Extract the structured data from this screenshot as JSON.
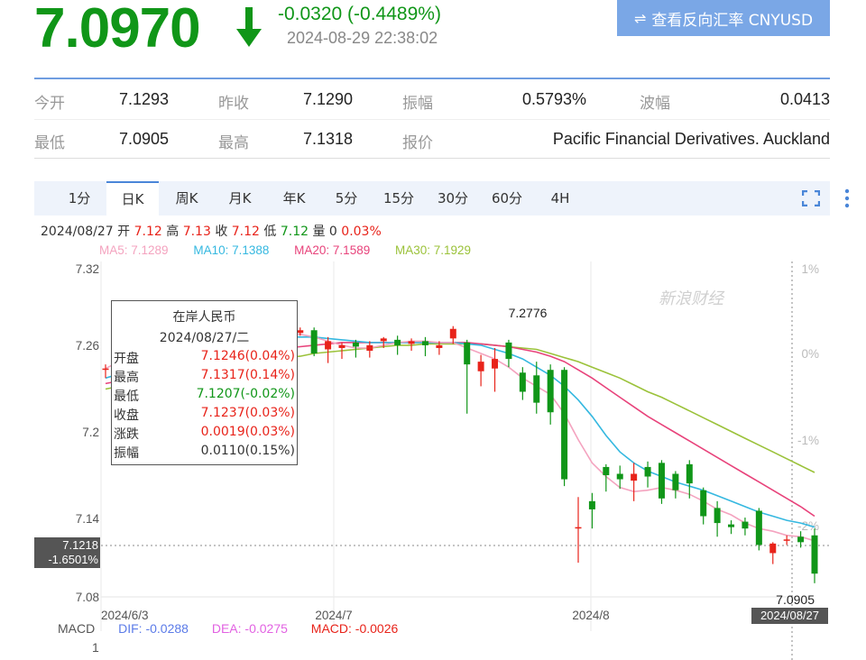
{
  "header": {
    "price": "7.0970",
    "change": "-0.0320 (-0.4489%)",
    "timestamp": "2024-08-29 22:38:02",
    "reverse_button_label": "查看反向汇率 CNYUSD",
    "colors": {
      "down": "#109618",
      "up": "#e8231a",
      "accent": "#7aa7e6"
    }
  },
  "quote": {
    "rows": [
      [
        {
          "label": "今开",
          "value": "7.1293"
        },
        {
          "label": "昨收",
          "value": "7.1290"
        },
        {
          "label": "振幅",
          "value": "0.5793%"
        },
        {
          "label": "波幅",
          "value": "0.0413"
        }
      ],
      [
        {
          "label": "最低",
          "value": "7.0905"
        },
        {
          "label": "最高",
          "value": "7.1318"
        },
        {
          "label": "报价",
          "value": "Pacific Financial Derivatives. Auckland"
        }
      ]
    ]
  },
  "tabs": [
    "1分",
    "日K",
    "周K",
    "月K",
    "年K",
    "5分",
    "15分",
    "30分",
    "60分",
    "4H"
  ],
  "active_tab": "日K",
  "icons": [
    "expand-icon",
    "more-vertical-icon",
    "swap-icon",
    "down-arrow-icon"
  ],
  "ohlc_line": {
    "date": "2024/08/27",
    "open_label": "开",
    "open": "7.12",
    "high_label": "高",
    "high": "7.13",
    "close_label": "收",
    "close": "7.12",
    "low_label": "低",
    "low": "7.12",
    "vol_label": "量",
    "vol": "0",
    "pct": "0.03%"
  },
  "ma": [
    {
      "label": "MA5: 7.1289",
      "color": "#f4a3bf"
    },
    {
      "label": "MA10: 7.1388",
      "color": "#35b8e0"
    },
    {
      "label": "MA20: 7.1589",
      "color": "#e8437b"
    },
    {
      "label": "MA30: 7.1929",
      "color": "#9bc23a"
    }
  ],
  "tooltip": {
    "title": "在岸人民币",
    "date": "2024/08/27/二",
    "rows": [
      {
        "label": "开盘",
        "value": "7.1246(0.04%)",
        "color": "red"
      },
      {
        "label": "最高",
        "value": "7.1317(0.14%)",
        "color": "red"
      },
      {
        "label": "最低",
        "value": "7.1207(-0.02%)",
        "color": "grn"
      },
      {
        "label": "收盘",
        "value": "7.1237(0.03%)",
        "color": "red"
      },
      {
        "label": "涨跌",
        "value": "0.0019(0.03%)",
        "color": "red"
      },
      {
        "label": "振幅",
        "value": "0.0110(0.15%)",
        "color": "black"
      }
    ]
  },
  "markers": {
    "high_label": "7.2776",
    "low_label": "7.0905",
    "cursor_price": "7.1218",
    "cursor_pct": "-1.6501%",
    "cursor_date": "2024/08/27"
  },
  "macd": {
    "title": "MACD",
    "dif": "DIF: -0.0288",
    "dea": "DEA: -0.0275",
    "macd": "MACD: -0.0026",
    "axis_label": "1"
  },
  "watermark": "新浪财经",
  "chart_data": {
    "type": "candlestick",
    "y_ticks": [
      "7.32",
      "7.26",
      "7.2",
      "7.14",
      "7.08"
    ],
    "pct_ticks": [
      "1%",
      "0%",
      "-1%",
      "-2%"
    ],
    "x_ticks": [
      "2024/6/3",
      "2024/7",
      "2024/8"
    ],
    "ylim": [
      7.08,
      7.32
    ],
    "candles": [
      {
        "o": 7.246,
        "c": 7.247,
        "h": 7.25,
        "l": 7.24
      },
      {
        "o": 7.27,
        "c": 7.272,
        "h": 7.275,
        "l": 7.266
      },
      {
        "o": 7.27,
        "c": 7.272,
        "h": 7.276,
        "l": 7.267
      },
      {
        "o": 7.27,
        "c": 7.272,
        "h": 7.275,
        "l": 7.267
      },
      {
        "o": 7.272,
        "c": 7.27,
        "h": 7.275,
        "l": 7.267
      },
      {
        "o": 7.27,
        "c": 7.273,
        "h": 7.276,
        "l": 7.268
      },
      {
        "o": 7.271,
        "c": 7.272,
        "h": 7.275,
        "l": 7.268
      },
      {
        "o": 7.272,
        "c": 7.27,
        "h": 7.274,
        "l": 7.268
      },
      {
        "o": 7.271,
        "c": 7.273,
        "h": 7.276,
        "l": 7.268
      },
      {
        "o": 7.27,
        "c": 7.272,
        "h": 7.275,
        "l": 7.267
      },
      {
        "o": 7.271,
        "c": 7.273,
        "h": 7.276,
        "l": 7.269
      },
      {
        "o": 7.272,
        "c": 7.274,
        "h": 7.276,
        "l": 7.27
      },
      {
        "o": 7.273,
        "c": 7.275,
        "h": 7.277,
        "l": 7.27
      },
      {
        "o": 7.274,
        "c": 7.272,
        "h": 7.276,
        "l": 7.27
      },
      {
        "o": 7.273,
        "c": 7.275,
        "h": 7.277,
        "l": 7.271
      },
      {
        "o": 7.275,
        "c": 7.258,
        "h": 7.277,
        "l": 7.256
      },
      {
        "o": 7.261,
        "c": 7.267,
        "h": 7.27,
        "l": 7.251
      },
      {
        "o": 7.262,
        "c": 7.264,
        "h": 7.266,
        "l": 7.254
      },
      {
        "o": 7.266,
        "c": 7.263,
        "h": 7.268,
        "l": 7.255
      },
      {
        "o": 7.26,
        "c": 7.264,
        "h": 7.267,
        "l": 7.255
      },
      {
        "o": 7.267,
        "c": 7.269,
        "h": 7.27,
        "l": 7.262
      },
      {
        "o": 7.268,
        "c": 7.264,
        "h": 7.271,
        "l": 7.257
      },
      {
        "o": 7.265,
        "c": 7.267,
        "h": 7.269,
        "l": 7.26
      },
      {
        "o": 7.267,
        "c": 7.264,
        "h": 7.27,
        "l": 7.256
      },
      {
        "o": 7.262,
        "c": 7.264,
        "h": 7.267,
        "l": 7.257
      },
      {
        "o": 7.269,
        "c": 7.276,
        "h": 7.278,
        "l": 7.265
      },
      {
        "o": 7.266,
        "c": 7.25,
        "h": 7.268,
        "l": 7.214
      },
      {
        "o": 7.245,
        "c": 7.252,
        "h": 7.257,
        "l": 7.234
      },
      {
        "o": 7.247,
        "c": 7.254,
        "h": 7.262,
        "l": 7.23
      },
      {
        "o": 7.266,
        "c": 7.254,
        "h": 7.268,
        "l": 7.248
      },
      {
        "o": 7.244,
        "c": 7.23,
        "h": 7.248,
        "l": 7.224
      },
      {
        "o": 7.242,
        "c": 7.222,
        "h": 7.252,
        "l": 7.214
      },
      {
        "o": 7.246,
        "c": 7.215,
        "h": 7.25,
        "l": 7.206
      },
      {
        "o": 7.246,
        "c": 7.166,
        "h": 7.248,
        "l": 7.161
      },
      {
        "o": 7.13,
        "c": 7.131,
        "h": 7.153,
        "l": 7.105
      },
      {
        "o": 7.15,
        "c": 7.144,
        "h": 7.156,
        "l": 7.13
      },
      {
        "o": 7.175,
        "c": 7.169,
        "h": 7.177,
        "l": 7.157
      },
      {
        "o": 7.17,
        "c": 7.166,
        "h": 7.176,
        "l": 7.159
      },
      {
        "o": 7.165,
        "c": 7.17,
        "h": 7.178,
        "l": 7.15
      },
      {
        "o": 7.175,
        "c": 7.168,
        "h": 7.179,
        "l": 7.16
      },
      {
        "o": 7.178,
        "c": 7.152,
        "h": 7.18,
        "l": 7.148
      },
      {
        "o": 7.17,
        "c": 7.158,
        "h": 7.172,
        "l": 7.152
      },
      {
        "o": 7.177,
        "c": 7.163,
        "h": 7.18,
        "l": 7.152
      },
      {
        "o": 7.158,
        "c": 7.139,
        "h": 7.16,
        "l": 7.133
      },
      {
        "o": 7.145,
        "c": 7.134,
        "h": 7.15,
        "l": 7.124
      },
      {
        "o": 7.133,
        "c": 7.131,
        "h": 7.136,
        "l": 7.126
      },
      {
        "o": 7.135,
        "c": 7.13,
        "h": 7.138,
        "l": 7.125
      },
      {
        "o": 7.143,
        "c": 7.118,
        "h": 7.145,
        "l": 7.114
      },
      {
        "o": 7.112,
        "c": 7.119,
        "h": 7.12,
        "l": 7.104
      },
      {
        "o": 7.121,
        "c": 7.122,
        "h": 7.125,
        "l": 7.118
      },
      {
        "o": 7.124,
        "c": 7.12,
        "h": 7.128,
        "l": 7.116
      },
      {
        "o": 7.125,
        "c": 7.097,
        "h": 7.13,
        "l": 7.09
      }
    ],
    "ma5": [
      7.247,
      7.252,
      7.258,
      7.262,
      7.266,
      7.268,
      7.27,
      7.271,
      7.27,
      7.271,
      7.272,
      7.272,
      7.272,
      7.272,
      7.272,
      7.27,
      7.267,
      7.264,
      7.262,
      7.262,
      7.264,
      7.266,
      7.267,
      7.267,
      7.266,
      7.266,
      7.262,
      7.258,
      7.254,
      7.248,
      7.24,
      7.234,
      7.228,
      7.214,
      7.195,
      7.178,
      7.168,
      7.16,
      7.157,
      7.158,
      7.16,
      7.158,
      7.155,
      7.15,
      7.144,
      7.14,
      7.134,
      7.13,
      7.128,
      7.125,
      7.124,
      7.121
    ],
    "ma10": [
      7.24,
      7.243,
      7.246,
      7.25,
      7.252,
      7.256,
      7.259,
      7.262,
      7.264,
      7.265,
      7.267,
      7.268,
      7.269,
      7.27,
      7.27,
      7.27,
      7.269,
      7.268,
      7.267,
      7.266,
      7.266,
      7.266,
      7.266,
      7.266,
      7.266,
      7.266,
      7.265,
      7.264,
      7.261,
      7.258,
      7.254,
      7.248,
      7.242,
      7.234,
      7.224,
      7.212,
      7.198,
      7.186,
      7.178,
      7.172,
      7.168,
      7.164,
      7.161,
      7.158,
      7.154,
      7.15,
      7.146,
      7.142,
      7.139,
      7.136,
      7.134,
      7.131
    ],
    "ma20": [
      7.236,
      7.238,
      7.24,
      7.242,
      7.244,
      7.246,
      7.248,
      7.25,
      7.252,
      7.254,
      7.256,
      7.258,
      7.26,
      7.262,
      7.263,
      7.264,
      7.265,
      7.266,
      7.266,
      7.266,
      7.266,
      7.266,
      7.266,
      7.266,
      7.266,
      7.266,
      7.266,
      7.265,
      7.264,
      7.263,
      7.261,
      7.259,
      7.256,
      7.252,
      7.246,
      7.24,
      7.233,
      7.226,
      7.219,
      7.212,
      7.206,
      7.2,
      7.194,
      7.188,
      7.182,
      7.176,
      7.17,
      7.164,
      7.158,
      7.152,
      7.146,
      7.139
    ],
    "ma30": [
      7.232,
      7.234,
      7.236,
      7.238,
      7.24,
      7.241,
      7.243,
      7.245,
      7.246,
      7.248,
      7.25,
      7.251,
      7.253,
      7.255,
      7.256,
      7.258,
      7.259,
      7.26,
      7.261,
      7.262,
      7.263,
      7.264,
      7.264,
      7.265,
      7.265,
      7.265,
      7.265,
      7.265,
      7.264,
      7.263,
      7.262,
      7.261,
      7.258,
      7.255,
      7.252,
      7.248,
      7.244,
      7.24,
      7.235,
      7.23,
      7.226,
      7.221,
      7.216,
      7.211,
      7.206,
      7.201,
      7.196,
      7.191,
      7.186,
      7.181,
      7.176,
      7.171
    ]
  }
}
